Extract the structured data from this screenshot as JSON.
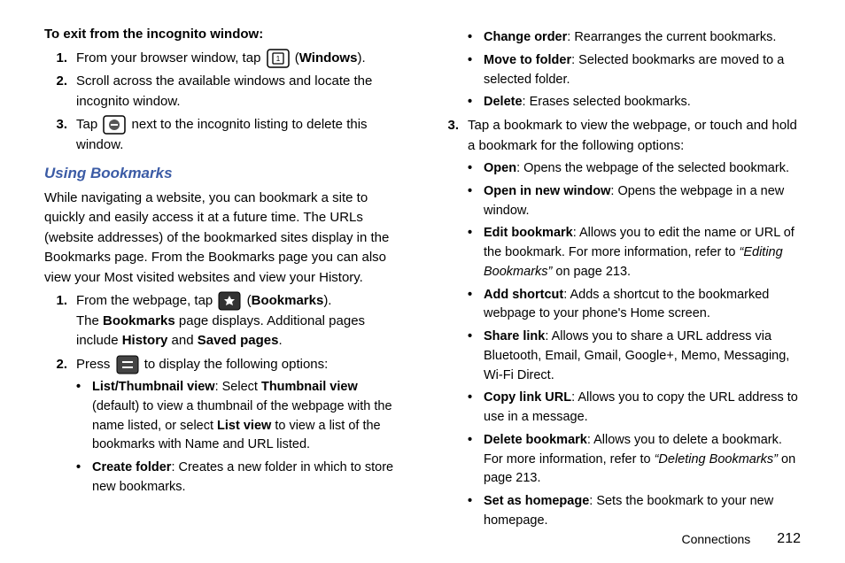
{
  "left": {
    "exitHeading": "To exit from the incognito window:",
    "exitSteps": {
      "s1a": "From your browser window, tap ",
      "s1b": " (",
      "s1c": "Windows",
      "s1d": ").",
      "s2": "Scroll across the available windows and locate the incognito window.",
      "s3a": "Tap ",
      "s3b": " next to the incognito listing to delete this window."
    },
    "bookmarksHeading": "Using Bookmarks",
    "bookmarksIntro": "While navigating a website, you can bookmark a site to quickly and easily access it at a future time. The URLs (website addresses) of the bookmarked sites display in the Bookmarks page. From the Bookmarks page you can also view your Most visited websites and view your History.",
    "bmSteps": {
      "s1a": "From the webpage, tap ",
      "s1b": " (",
      "s1c": "Bookmarks",
      "s1d": ").",
      "s1e": "The ",
      "s1f": "Bookmarks",
      "s1g": " page displays. Additional pages include ",
      "s1h": "History",
      "s1i": " and ",
      "s1j": "Saved pages",
      "s1k": ".",
      "s2a": "Press ",
      "s2b": " to display the following options:",
      "b1a": "List/Thumbnail view",
      "b1b": ": Select ",
      "b1c": "Thumbnail view",
      "b1d": " (default) to view a thumbnail of the webpage with the name listed, or select ",
      "b1e": "List view",
      "b1f": " to view a list of the bookmarks with Name and URL listed.",
      "b2a": "Create folder",
      "b2b": ": Creates a new folder in which to store new bookmarks."
    }
  },
  "right": {
    "topBullets": {
      "b1a": "Change order",
      "b1b": ": Rearranges the current bookmarks.",
      "b2a": "Move to folder",
      "b2b": ": Selected bookmarks are moved to a selected folder.",
      "b3a": "Delete",
      "b3b": ": Erases selected bookmarks."
    },
    "step3": "Tap a bookmark to view the webpage, or touch and hold a bookmark for the following options:",
    "step3Bullets": {
      "b1a": "Open",
      "b1b": ": Opens the webpage of the selected bookmark.",
      "b2a": "Open in new window",
      "b2b": ": Opens the webpage in a new window.",
      "b3a": "Edit bookmark",
      "b3b": ": Allows you to edit the name or URL of the bookmark. For more information, refer to ",
      "b3c": "“Editing Bookmarks”",
      "b3d": "  on page 213.",
      "b4a": "Add shortcut",
      "b4b": ": Adds a shortcut to the bookmarked webpage to your phone's Home screen.",
      "b5a": "Share link",
      "b5b": ": Allows you to share a URL address via Bluetooth, Email, Gmail, Google+, Memo, Messaging, Wi-Fi Direct.",
      "b6a": "Copy link URL",
      "b6b": ": Allows you to copy the URL address to use in a message.",
      "b7a": "Delete bookmark",
      "b7b": ": Allows you to delete a bookmark. For more information, refer to ",
      "b7c": "“Deleting Bookmarks”",
      "b7d": "  on page 213.",
      "b8a": "Set as homepage",
      "b8b": ": Sets the bookmark to your new homepage."
    }
  },
  "footer": {
    "section": "Connections",
    "page": "212"
  }
}
